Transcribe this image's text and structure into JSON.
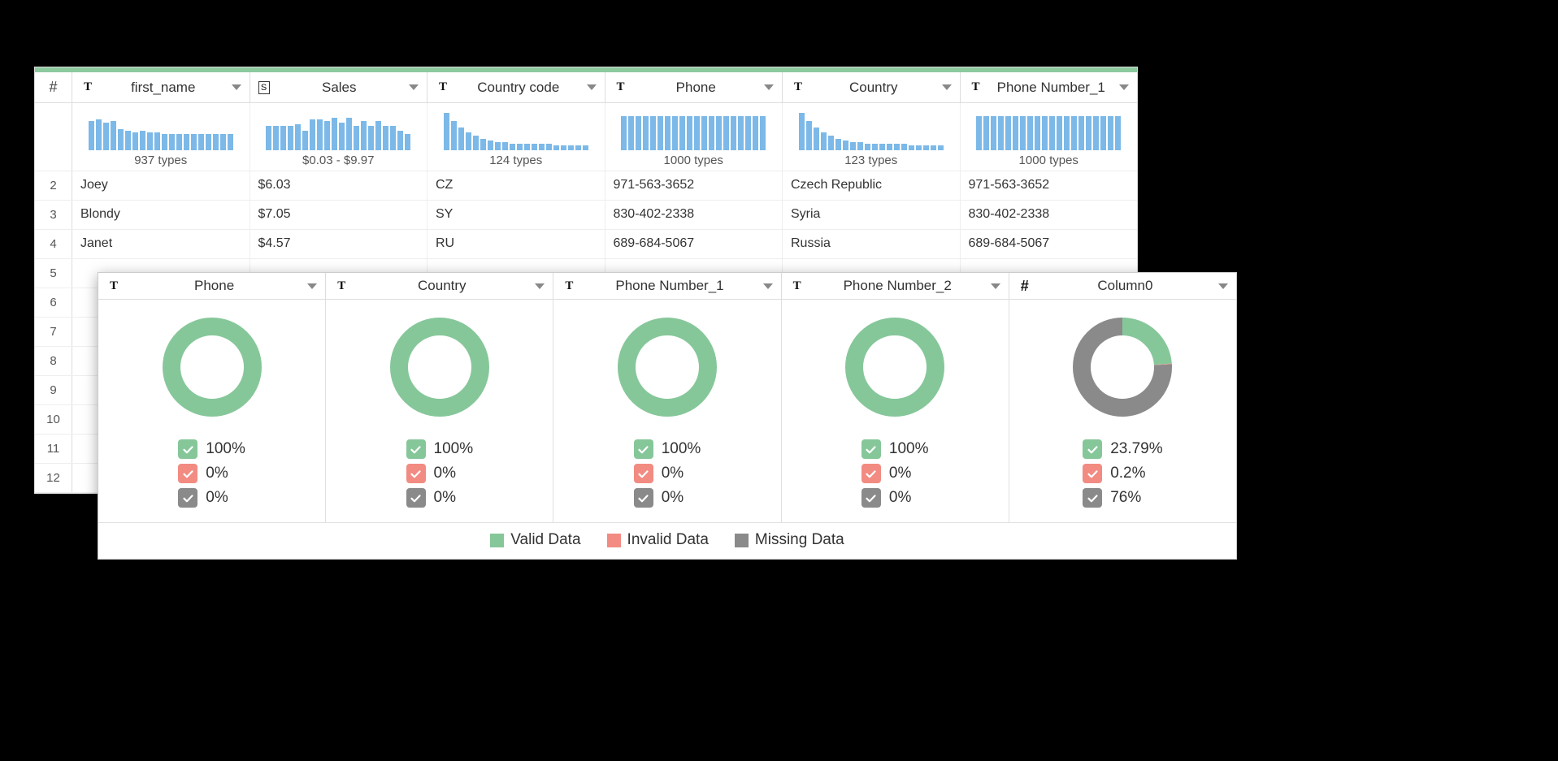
{
  "colors": {
    "valid": "#86c79a",
    "invalid": "#f28b82",
    "missing": "#8a8a8a",
    "bar": "#7cb9e8"
  },
  "back": {
    "hash_label": "#",
    "columns": [
      {
        "name": "first_name",
        "type": "T",
        "chart_label": "937 types",
        "bars": [
          36,
          38,
          34,
          36,
          26,
          24,
          22,
          24,
          22,
          22,
          20,
          20,
          20,
          20,
          20,
          20,
          20,
          20,
          20,
          20
        ]
      },
      {
        "name": "Sales",
        "type": "S",
        "chart_label": "$0.03 - $9.97",
        "bars": [
          30,
          30,
          30,
          30,
          32,
          24,
          38,
          38,
          36,
          40,
          34,
          40,
          30,
          36,
          30,
          36,
          30,
          30,
          24,
          20
        ]
      },
      {
        "name": "Country code",
        "type": "T",
        "chart_label": "124 types",
        "bars": [
          46,
          36,
          28,
          22,
          18,
          14,
          12,
          10,
          10,
          8,
          8,
          8,
          8,
          8,
          8,
          6,
          6,
          6,
          6,
          6
        ]
      },
      {
        "name": "Phone",
        "type": "T",
        "chart_label": "1000 types",
        "bars": [
          42,
          42,
          42,
          42,
          42,
          42,
          42,
          42,
          42,
          42,
          42,
          42,
          42,
          42,
          42,
          42,
          42,
          42,
          42,
          42
        ]
      },
      {
        "name": "Country",
        "type": "T",
        "chart_label": "123 types",
        "bars": [
          46,
          36,
          28,
          22,
          18,
          14,
          12,
          10,
          10,
          8,
          8,
          8,
          8,
          8,
          8,
          6,
          6,
          6,
          6,
          6
        ]
      },
      {
        "name": "Phone Number_1",
        "type": "T",
        "chart_label": "1000 types",
        "bars": [
          42,
          42,
          42,
          42,
          42,
          42,
          42,
          42,
          42,
          42,
          42,
          42,
          42,
          42,
          42,
          42,
          42,
          42,
          42,
          42
        ]
      }
    ],
    "rows": [
      {
        "n": "2",
        "cells": [
          "Joey",
          "$6.03",
          "CZ",
          "971-563-3652",
          "Czech Republic",
          "971-563-3652"
        ]
      },
      {
        "n": "3",
        "cells": [
          "Blondy",
          "$7.05",
          "SY",
          "830-402-2338",
          "Syria",
          "830-402-2338"
        ]
      },
      {
        "n": "4",
        "cells": [
          "Janet",
          "$4.57",
          "RU",
          "689-684-5067",
          "Russia",
          "689-684-5067"
        ]
      }
    ],
    "empty_rows": [
      "5",
      "6",
      "7",
      "8",
      "9",
      "10",
      "11",
      "12"
    ]
  },
  "front": {
    "columns": [
      {
        "name": "Phone",
        "type": "T",
        "valid": "100%",
        "invalid": "0%",
        "missing": "0%",
        "donut": {
          "valid": 100,
          "invalid": 0,
          "missing": 0
        }
      },
      {
        "name": "Country",
        "type": "T",
        "valid": "100%",
        "invalid": "0%",
        "missing": "0%",
        "donut": {
          "valid": 100,
          "invalid": 0,
          "missing": 0
        }
      },
      {
        "name": "Phone Number_1",
        "type": "T",
        "valid": "100%",
        "invalid": "0%",
        "missing": "0%",
        "donut": {
          "valid": 100,
          "invalid": 0,
          "missing": 0
        }
      },
      {
        "name": "Phone Number_2",
        "type": "T",
        "valid": "100%",
        "invalid": "0%",
        "missing": "0%",
        "donut": {
          "valid": 100,
          "invalid": 0,
          "missing": 0
        }
      },
      {
        "name": "Column0",
        "type": "#",
        "valid": "23.79%",
        "invalid": "0.2%",
        "missing": "76%",
        "donut": {
          "valid": 23.79,
          "invalid": 0.2,
          "missing": 76.01
        }
      }
    ],
    "legend": {
      "valid": "Valid Data",
      "invalid": "Invalid Data",
      "missing": "Missing Data"
    }
  },
  "chart_data": [
    {
      "type": "bar",
      "title": "first_name distribution",
      "values": [
        36,
        38,
        34,
        36,
        26,
        24,
        22,
        24,
        22,
        22,
        20,
        20,
        20,
        20,
        20,
        20,
        20,
        20,
        20,
        20
      ],
      "label": "937 types"
    },
    {
      "type": "bar",
      "title": "Sales distribution",
      "values": [
        30,
        30,
        30,
        30,
        32,
        24,
        38,
        38,
        36,
        40,
        34,
        40,
        30,
        36,
        30,
        36,
        30,
        30,
        24,
        20
      ],
      "label": "$0.03 - $9.97"
    },
    {
      "type": "bar",
      "title": "Country code distribution",
      "values": [
        46,
        36,
        28,
        22,
        18,
        14,
        12,
        10,
        10,
        8,
        8,
        8,
        8,
        8,
        8,
        6,
        6,
        6,
        6,
        6
      ],
      "label": "124 types"
    },
    {
      "type": "bar",
      "title": "Phone distribution",
      "values": [
        42,
        42,
        42,
        42,
        42,
        42,
        42,
        42,
        42,
        42,
        42,
        42,
        42,
        42,
        42,
        42,
        42,
        42,
        42,
        42
      ],
      "label": "1000 types"
    },
    {
      "type": "bar",
      "title": "Country distribution",
      "values": [
        46,
        36,
        28,
        22,
        18,
        14,
        12,
        10,
        10,
        8,
        8,
        8,
        8,
        8,
        8,
        6,
        6,
        6,
        6,
        6
      ],
      "label": "123 types"
    },
    {
      "type": "bar",
      "title": "Phone Number_1 distribution",
      "values": [
        42,
        42,
        42,
        42,
        42,
        42,
        42,
        42,
        42,
        42,
        42,
        42,
        42,
        42,
        42,
        42,
        42,
        42,
        42,
        42
      ],
      "label": "1000 types"
    },
    {
      "type": "pie",
      "title": "Phone data quality",
      "series": [
        {
          "name": "Valid",
          "value": 100
        },
        {
          "name": "Invalid",
          "value": 0
        },
        {
          "name": "Missing",
          "value": 0
        }
      ]
    },
    {
      "type": "pie",
      "title": "Country data quality",
      "series": [
        {
          "name": "Valid",
          "value": 100
        },
        {
          "name": "Invalid",
          "value": 0
        },
        {
          "name": "Missing",
          "value": 0
        }
      ]
    },
    {
      "type": "pie",
      "title": "Phone Number_1 data quality",
      "series": [
        {
          "name": "Valid",
          "value": 100
        },
        {
          "name": "Invalid",
          "value": 0
        },
        {
          "name": "Missing",
          "value": 0
        }
      ]
    },
    {
      "type": "pie",
      "title": "Phone Number_2 data quality",
      "series": [
        {
          "name": "Valid",
          "value": 100
        },
        {
          "name": "Invalid",
          "value": 0
        },
        {
          "name": "Missing",
          "value": 0
        }
      ]
    },
    {
      "type": "pie",
      "title": "Column0 data quality",
      "series": [
        {
          "name": "Valid",
          "value": 23.79
        },
        {
          "name": "Invalid",
          "value": 0.2
        },
        {
          "name": "Missing",
          "value": 76.01
        }
      ]
    }
  ]
}
